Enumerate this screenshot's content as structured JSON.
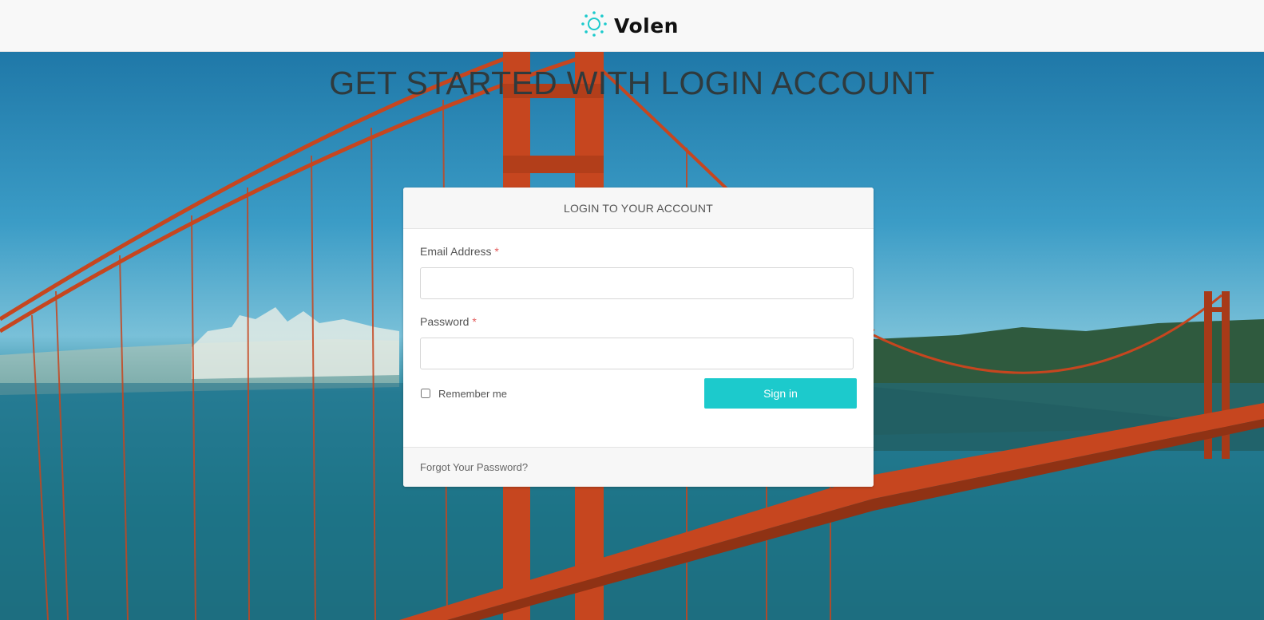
{
  "brand": {
    "name": "Volen",
    "icon": "sun-icon",
    "accent": "#1ccacc"
  },
  "hero": {
    "headline": "GET STARTED WITH LOGIN ACCOUNT",
    "background": "golden-gate-bridge-photo"
  },
  "login": {
    "title": "LOGIN TO YOUR ACCOUNT",
    "email": {
      "label": "Email Address",
      "required_mark": "*",
      "value": "",
      "placeholder": ""
    },
    "password": {
      "label": "Password",
      "required_mark": "*",
      "value": "",
      "placeholder": ""
    },
    "remember_label": "Remember me",
    "remember_checked": false,
    "submit_label": "Sign in",
    "forgot_label": "Forgot Your Password?"
  }
}
